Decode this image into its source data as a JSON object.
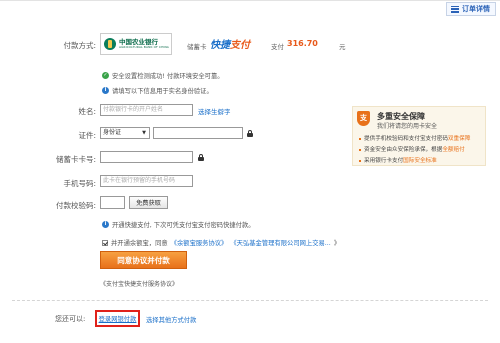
{
  "header": {
    "order_detail_label": "订单详情"
  },
  "payment": {
    "method_label": "付款方式:",
    "bank_name_cn": "中国农业银行",
    "bank_name_en": "AGRICULTURAL BANK OF CHINA",
    "card_type": "储蓄卡",
    "express_left": "快捷",
    "express_right": "支付",
    "amount_label": "支付",
    "amount_value": "316.70",
    "amount_unit": "元"
  },
  "notices": {
    "security_ok": "安全设置检测成功! 付款环境安全可靠。",
    "fill_info": "请填写以下信息用于实名身份验证。"
  },
  "form": {
    "name_label": "姓名:",
    "name_placeholder": "付款银行卡的开户姓名",
    "rare_char_link": "选择生僻字",
    "id_label": "证件:",
    "id_type": "身份证",
    "card_label": "储蓄卡卡号:",
    "phone_label": "手机号码:",
    "phone_placeholder": "此卡在银行预留的手机号码",
    "code_label": "付款校验码:",
    "sms_button": "免费获取",
    "quick_pay_notice": "开通快捷支付, 下次可凭支付宝支付密码快捷付款。",
    "agree_prefix": "并开通余额宝，同意",
    "agree_link1": "《余额宝服务协议》",
    "agree_link2": "《天弘基金管理有限公司网上交易...",
    "agree_suffix": "》",
    "submit_button": "同意协议并付款",
    "alipay_agreement": "《支付宝快捷支付服务协议》"
  },
  "security_panel": {
    "title": "多重安全保障",
    "subtitle": "我们将请您的用卡安全",
    "items": [
      {
        "prefix": "提供手机校验码和支付宝支付密码",
        "highlight": "双重保障"
      },
      {
        "prefix": "资金安全由众安保险承保，根据",
        "highlight": "全额赔付"
      },
      {
        "prefix": "采用银行卡支付",
        "highlight": "国际安全标准"
      }
    ]
  },
  "footer": {
    "other_label": "您还可以:",
    "login_bank_link": "登录网银付款",
    "other_method_link": "选择其他方式付款"
  },
  "colors": {
    "accent": "#e8711a",
    "link": "#1a6fc9",
    "highlight_border": "#e0221b",
    "bank_green": "#0a6b4a"
  }
}
